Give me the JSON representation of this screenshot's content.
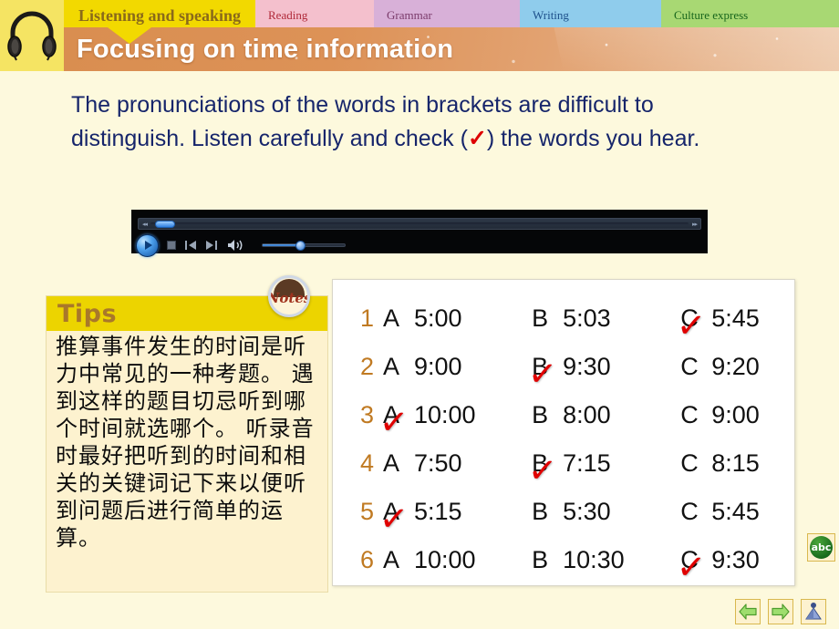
{
  "tabs": [
    {
      "label": "Listening and\nspeaking",
      "active": true
    },
    {
      "label": "Reading",
      "active": false
    },
    {
      "label": "Grammar",
      "active": false
    },
    {
      "label": "Writing",
      "active": false
    },
    {
      "label": "Culture express",
      "active": false
    }
  ],
  "tab_labels": {
    "listening": "Listening and speaking",
    "reading": "Reading",
    "grammar": "Grammar",
    "writing": "Writing",
    "culture": "Culture express"
  },
  "banner": {
    "title": "Focusing on time information"
  },
  "instruction": {
    "part1": "The pronunciations of the words in brackets are difficult to distinguish. Listen carefully and check (",
    "check_mark": "✓",
    "part2": ") the words you hear."
  },
  "player": {
    "play_label": "play",
    "stop_label": "stop",
    "prev_label": "previous",
    "next_label": "next",
    "volume_label": "volume",
    "seek_left_marks": "◂◂",
    "seek_right_marks": "▸▸",
    "prev_glyph": "⏮",
    "next_glyph": "⏭",
    "speaker_glyph": "◂))"
  },
  "tips": {
    "header": "Tips",
    "body": "推算事件发生的时间是听力中常见的一种考题。 遇到这样的题目切忌听到哪个时间就选哪个。 听录音时最好把听到的时间和相关的关键词记下来以便听到问题后进行简单的运算。",
    "notes_badge": "Notes"
  },
  "answers": {
    "tick_glyph": "✓",
    "rows": [
      {
        "num": "1",
        "a_letter": "A",
        "a_value": "5:00",
        "b_letter": "B",
        "b_value": "5:03",
        "c_letter": "C",
        "c_value": "5:45",
        "checked": "C"
      },
      {
        "num": "2",
        "a_letter": "A",
        "a_value": "9:00",
        "b_letter": "B",
        "b_value": "9:30",
        "c_letter": "C",
        "c_value": "9:20",
        "checked": "B"
      },
      {
        "num": "3",
        "a_letter": "A",
        "a_value": "10:00",
        "b_letter": "B",
        "b_value": "8:00",
        "c_letter": "C",
        "c_value": "9:00",
        "checked": "A"
      },
      {
        "num": "4",
        "a_letter": "A",
        "a_value": "7:50",
        "b_letter": "B",
        "b_value": "7:15",
        "c_letter": "C",
        "c_value": "8:15",
        "checked": "B"
      },
      {
        "num": "5",
        "a_letter": "A",
        "a_value": "5:15",
        "b_letter": "B",
        "b_value": "5:30",
        "c_letter": "C",
        "c_value": "5:45",
        "checked": "A"
      },
      {
        "num": "6",
        "a_letter": "A",
        "a_value": "10:00",
        "b_letter": "B",
        "b_value": "10:30",
        "c_letter": "C",
        "c_value": "9:30",
        "checked": "C"
      }
    ]
  },
  "abc_button": {
    "label": "abc"
  },
  "nav": {
    "back_label": "back",
    "forward_label": "forward",
    "home_label": "home"
  },
  "colors": {
    "page_bg": "#fdf9dd",
    "active_tab": "#f2d900",
    "banner": "#dd9257",
    "instruction_text": "#16256b",
    "tick_red": "#dd0000",
    "tips_header": "#ecd400",
    "tips_body_bg": "#fdf2cf",
    "answer_num": "#c07a22"
  }
}
